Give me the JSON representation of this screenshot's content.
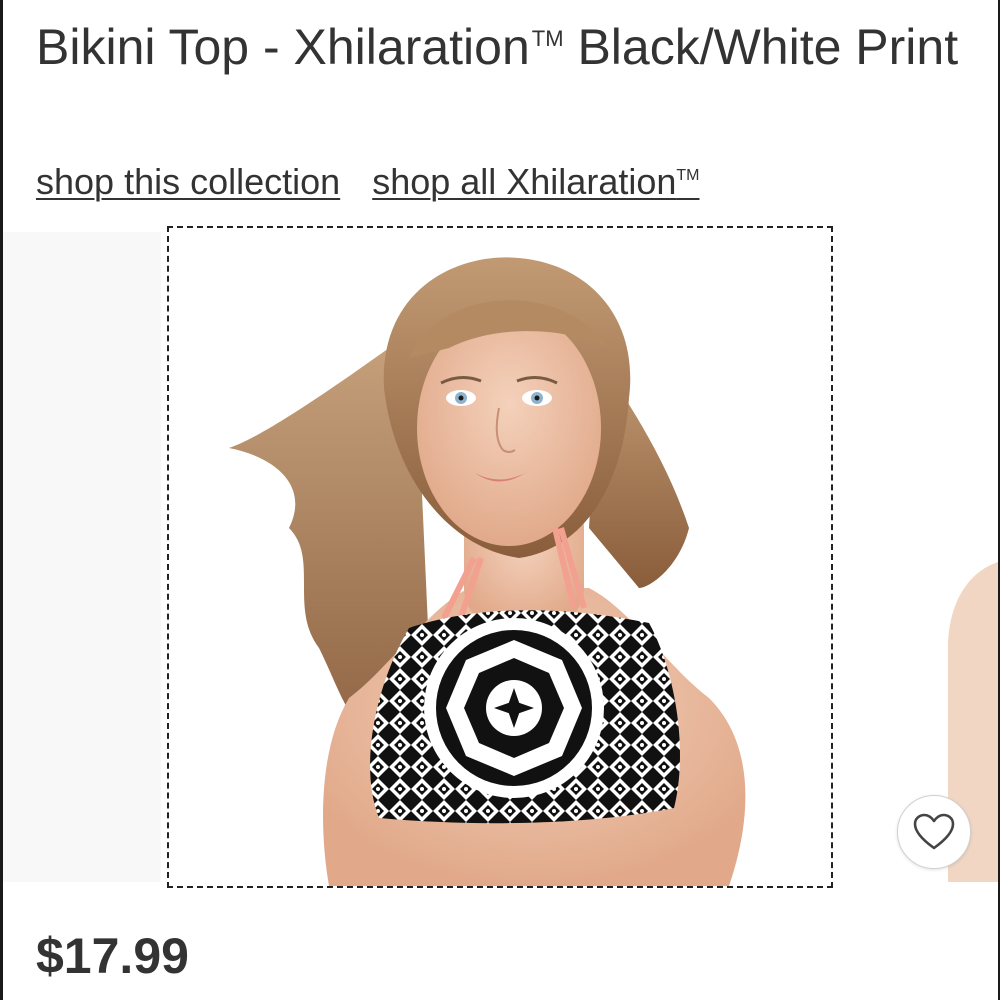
{
  "product": {
    "title_main": "Bikini Top - Xhilaration",
    "title_tm": "TM",
    "title_rest": " Black/White Print",
    "price": "$17.99"
  },
  "links": {
    "collection": "shop this collection",
    "brand": "shop all Xhilaration",
    "brand_tm": "TM"
  },
  "colors": {
    "text": "#333333",
    "swimsuit_pattern_dark": "#111111",
    "swimsuit_pattern_light": "#ffffff",
    "straps": "#f2a08f"
  },
  "icons": {
    "favorite": "heart-outline-icon"
  }
}
